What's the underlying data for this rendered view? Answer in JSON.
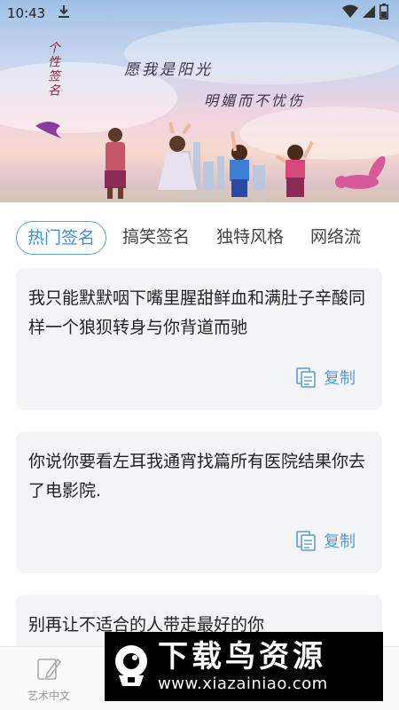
{
  "status_bar": {
    "time": "10:43",
    "download_icon": "download-icon",
    "wifi_icon": "wifi-icon",
    "signal_icon": "signal-icon",
    "battery_icon": "battery-icon"
  },
  "banner": {
    "vertical_text": "个性签名",
    "line1": "愿我是阳光",
    "line2": "明媚而不忧伤"
  },
  "tabs": [
    {
      "label": "热门签名",
      "active": true
    },
    {
      "label": "搞笑签名",
      "active": false
    },
    {
      "label": "独特风格",
      "active": false
    },
    {
      "label": "网络流",
      "active": false
    }
  ],
  "cards": [
    {
      "text": "我只能默默咽下嘴里腥甜鲜血和满肚子辛酸同样一个狼狈转身与你背道而驰",
      "copy_label": "复制"
    },
    {
      "text": "你说你要看左耳我通宵找篇所有医院结果你去了电影院.",
      "copy_label": "复制"
    },
    {
      "text": "别再让不适合的人带走最好的你",
      "copy_label": ""
    }
  ],
  "bottom_nav": {
    "item1": {
      "label": "艺术中文",
      "icon": "pen-icon"
    }
  },
  "watermark": {
    "title": "下载鸟资源",
    "url": "www.xiazainiao.com"
  },
  "colors": {
    "accent": "#3f8ed8",
    "card_bg": "#f3f4f6"
  }
}
